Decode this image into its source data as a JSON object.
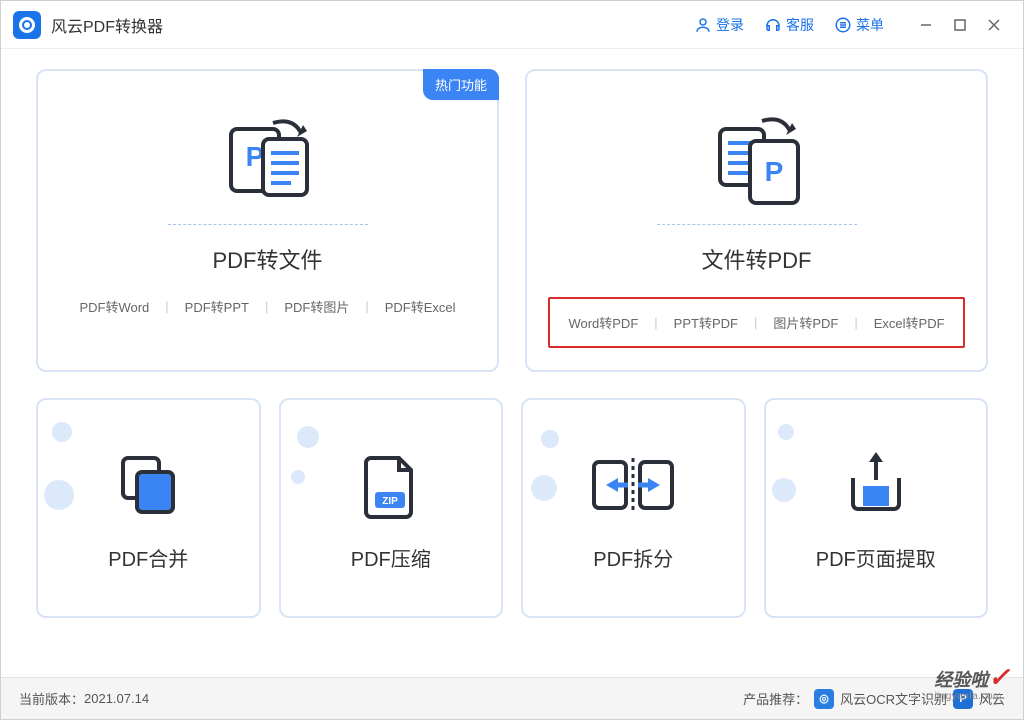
{
  "app": {
    "title": "风云PDF转换器"
  },
  "titlebar": {
    "login": "登录",
    "support": "客服",
    "menu": "菜单"
  },
  "cards": {
    "pdf_to_file": {
      "title": "PDF转文件",
      "badge": "热门功能",
      "options": [
        "PDF转Word",
        "PDF转PPT",
        "PDF转图片",
        "PDF转Excel"
      ]
    },
    "file_to_pdf": {
      "title": "文件转PDF",
      "options": [
        "Word转PDF",
        "PPT转PDF",
        "图片转PDF",
        "Excel转PDF"
      ]
    },
    "merge": {
      "title": "PDF合并"
    },
    "compress": {
      "title": "PDF压缩",
      "zip_label": "ZIP"
    },
    "split": {
      "title": "PDF拆分"
    },
    "extract": {
      "title": "PDF页面提取"
    }
  },
  "footer": {
    "version_label": "当前版本：",
    "version": "2021.07.14",
    "recommend_label": "产品推荐：",
    "rec1": "风云OCR文字识别",
    "rec2": "风云"
  },
  "watermark": {
    "brand": "经验啦",
    "url": "jingyanla.com"
  }
}
